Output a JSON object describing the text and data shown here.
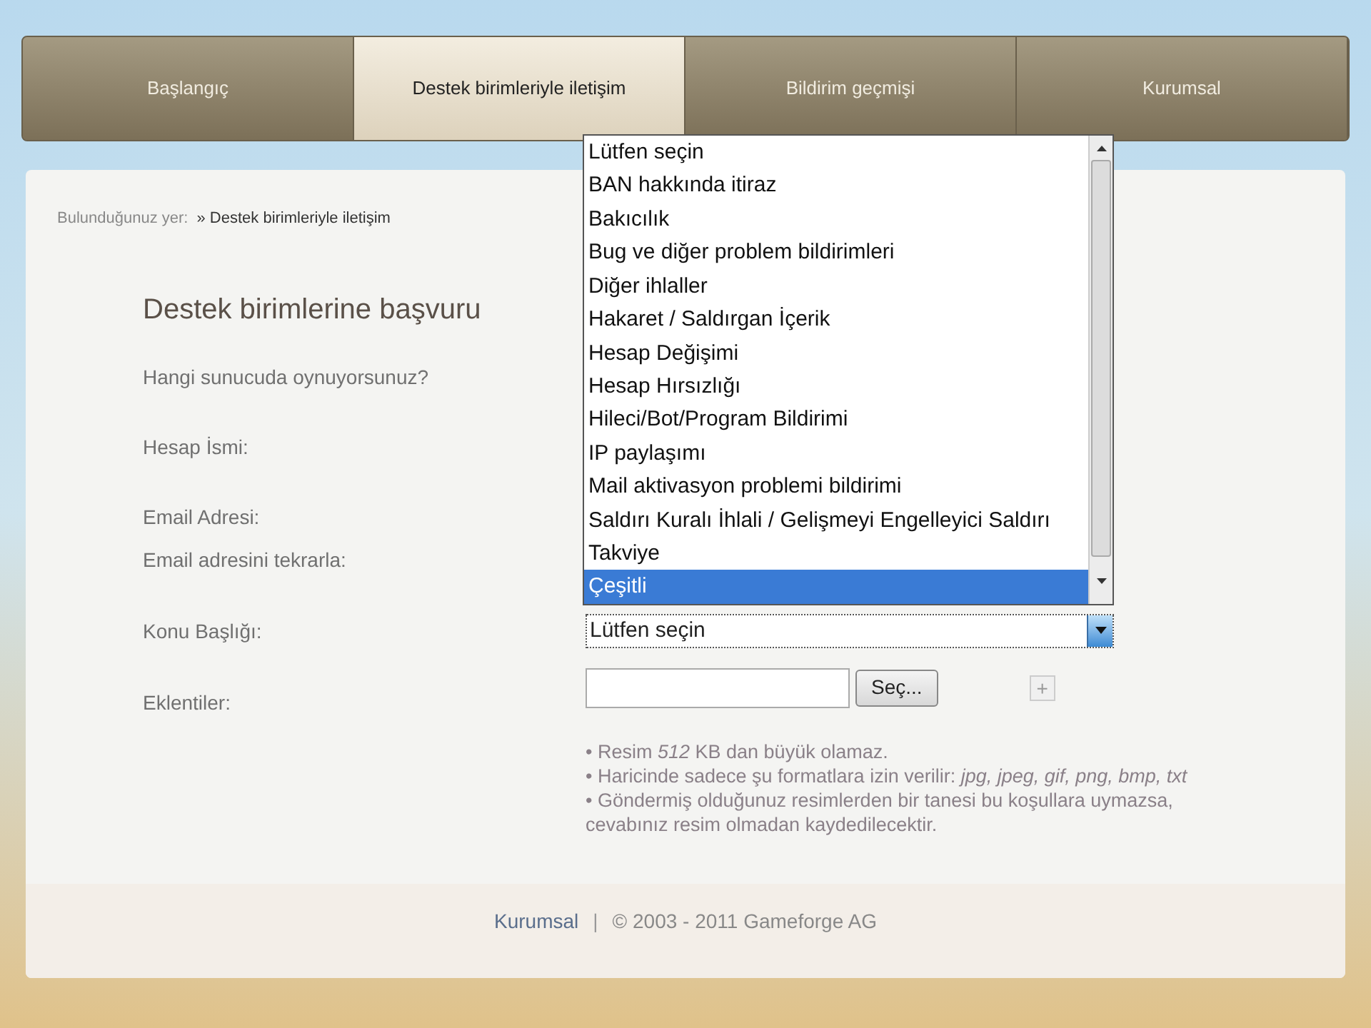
{
  "tabs": [
    {
      "label": "Başlangıç",
      "selected": false
    },
    {
      "label": "Destek birimleriyle iletişim",
      "selected": true
    },
    {
      "label": "Bildirim geçmişi",
      "selected": false
    },
    {
      "label": "Kurumsal",
      "selected": false
    }
  ],
  "breadcrumb": {
    "label": "Bulunduğunuz yer:",
    "current": "» Destek birimleriyle iletişim"
  },
  "form": {
    "title": "Destek birimlerine başvuru",
    "fields": [
      {
        "label": "Hangi sunucuda oynuyorsunuz?"
      },
      {
        "label": "Hesap İsmi:"
      },
      {
        "label": "Email Adresi:"
      },
      {
        "label": "Email adresini tekrarla:"
      },
      {
        "label": "Konu Başlığı:",
        "kind": "select",
        "value": "Lütfen seçin"
      },
      {
        "label": "Eklentiler:",
        "kind": "file",
        "button": "Seç...",
        "add": "+"
      }
    ],
    "notes": [
      "• Resim *512* KB dan büyük olamaz.",
      "• Haricinde sadece şu formatlara izin verilir: *jpg, jpeg, gif, png, bmp, txt*",
      "• Göndermiş olduğunuz resimlerden bir tanesi bu koşullara uymazsa, cevabınız resim olmadan kaydedilecektir."
    ]
  },
  "dropdown": {
    "options": [
      {
        "label": "Lütfen seçin",
        "selected": false
      },
      {
        "label": "BAN hakkında itiraz",
        "selected": false
      },
      {
        "label": "Bakıcılık",
        "selected": false
      },
      {
        "label": "Bug ve diğer problem bildirimleri",
        "selected": false
      },
      {
        "label": "Diğer ihlaller",
        "selected": false
      },
      {
        "label": "Hakaret / Saldırgan İçerik",
        "selected": false
      },
      {
        "label": "Hesap Değişimi",
        "selected": false
      },
      {
        "label": "Hesap Hırsızlığı",
        "selected": false
      },
      {
        "label": "Hileci/Bot/Program Bildirimi",
        "selected": false
      },
      {
        "label": "IP paylaşımı",
        "selected": false
      },
      {
        "label": "Mail aktivasyon problemi bildirimi",
        "selected": false
      },
      {
        "label": "Saldırı Kuralı İhlali / Gelişmeyi Engelleyici Saldırı",
        "selected": false
      },
      {
        "label": "Takviye",
        "selected": false
      },
      {
        "label": "Çeşitli",
        "selected": true
      }
    ]
  },
  "footer": {
    "link": "Kurumsal",
    "separator": "|",
    "copyright": "© 2003 - 2011 Gameforge AG"
  }
}
